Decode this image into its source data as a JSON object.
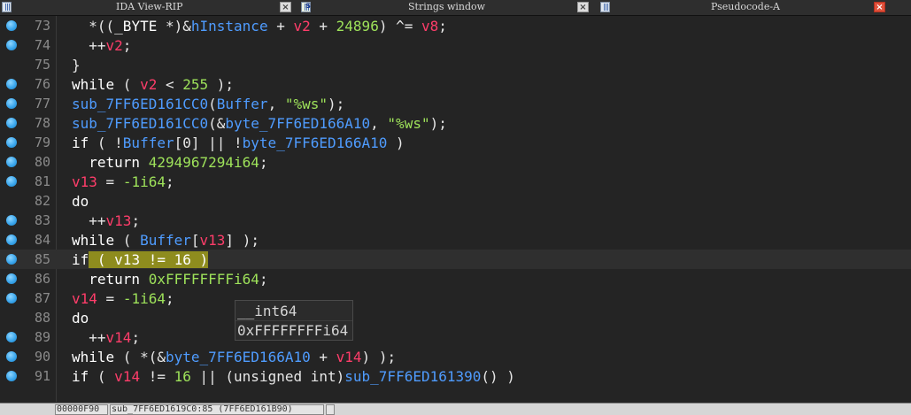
{
  "tabs": [
    {
      "label": "IDA View-RIP",
      "icon": "disassembly-view-icon",
      "close": "close-icon"
    },
    {
      "label": "Strings window",
      "icon": "strings-window-icon",
      "close": "close-icon"
    },
    {
      "label": "Pseudocode-A",
      "icon": "pseudocode-view-icon",
      "close": "close-icon"
    }
  ],
  "lines": [
    {
      "num": "73",
      "dot": true
    },
    {
      "num": "74",
      "dot": true
    },
    {
      "num": "75",
      "dot": false
    },
    {
      "num": "76",
      "dot": true
    },
    {
      "num": "77",
      "dot": true
    },
    {
      "num": "78",
      "dot": true
    },
    {
      "num": "79",
      "dot": true
    },
    {
      "num": "80",
      "dot": true
    },
    {
      "num": "81",
      "dot": true
    },
    {
      "num": "82",
      "dot": false
    },
    {
      "num": "83",
      "dot": true
    },
    {
      "num": "84",
      "dot": true
    },
    {
      "num": "85",
      "dot": true
    },
    {
      "num": "86",
      "dot": true
    },
    {
      "num": "87",
      "dot": true
    },
    {
      "num": "88",
      "dot": false
    },
    {
      "num": "89",
      "dot": true
    },
    {
      "num": "90",
      "dot": true
    },
    {
      "num": "91",
      "dot": true
    }
  ],
  "code": {
    "l73": {
      "a": "  *((",
      "b": "_BYTE",
      "c": " *)&",
      "d": "hInstance",
      "e": " + ",
      "f": "v2",
      "g": " + ",
      "h": "24896",
      "i": ") ^= ",
      "j": "v8",
      "k": ";"
    },
    "l74": {
      "a": "  ++",
      "b": "v2",
      "c": ";"
    },
    "l75": {
      "a": "}"
    },
    "l76": {
      "a": "while",
      "b": " ( ",
      "c": "v2",
      "d": " < ",
      "e": "255",
      "f": " );"
    },
    "l77": {
      "a": "sub_7FF6ED161CC0",
      "b": "(",
      "c": "Buffer",
      "d": ", ",
      "e": "\"%ws\"",
      "f": ");"
    },
    "l78": {
      "a": "sub_7FF6ED161CC0",
      "b": "(&",
      "c": "byte_7FF6ED166A10",
      "d": ", ",
      "e": "\"%ws\"",
      "f": ");"
    },
    "l79": {
      "a": "if",
      "b": " ( !",
      "c": "Buffer",
      "d": "[0] || !",
      "e": "byte_7FF6ED166A10",
      "f": " )"
    },
    "l80": {
      "a": "  return ",
      "b": "4294967294i64",
      "c": ";"
    },
    "l81": {
      "a": "v13",
      "b": " = ",
      "c": "-1i64",
      "d": ";"
    },
    "l82": {
      "a": "do"
    },
    "l83": {
      "a": "  ++",
      "b": "v13",
      "c": ";"
    },
    "l84": {
      "a": "while",
      "b": " ( ",
      "c": "Buffer",
      "d": "[",
      "e": "v13",
      "f": "] );"
    },
    "l85": {
      "a": "if",
      "b": " ( ",
      "c": "v13",
      "d": " != ",
      "e": "16",
      "f": " )"
    },
    "l86": {
      "a": "  return ",
      "b": "0xFFFFFFFFi64",
      "c": ";"
    },
    "l87": {
      "a": "v14",
      "b": " = ",
      "c": "-1i64",
      "d": ";"
    },
    "l88": {
      "a": "do"
    },
    "l89": {
      "a": "  ++",
      "b": "v14",
      "c": ";"
    },
    "l90": {
      "a": "while",
      "b": " ( *(&",
      "c": "byte_7FF6ED166A10",
      "d": " + ",
      "e": "v14",
      "f": ") );"
    },
    "l91": {
      "a": "if",
      "b": " ( ",
      "c": "v14",
      "d": " != ",
      "e": "16",
      "f": " || (unsigned int)",
      "g": "sub_7FF6ED161390",
      "h": "() )"
    }
  },
  "hint": {
    "type": "__int64",
    "value": "0xFFFFFFFFi64"
  },
  "status": {
    "offset": "00000F90",
    "location": "sub_7FF6ED1619C0:85 (7FF6ED161B90)"
  },
  "colors": {
    "background": "#242424",
    "keyword": "#ffffff",
    "variable": "#ff3d6a",
    "global": "#4f9cff",
    "number": "#9ee25a",
    "highlight": "#8e8c1e",
    "breakpoint": "#3aa6ec"
  }
}
